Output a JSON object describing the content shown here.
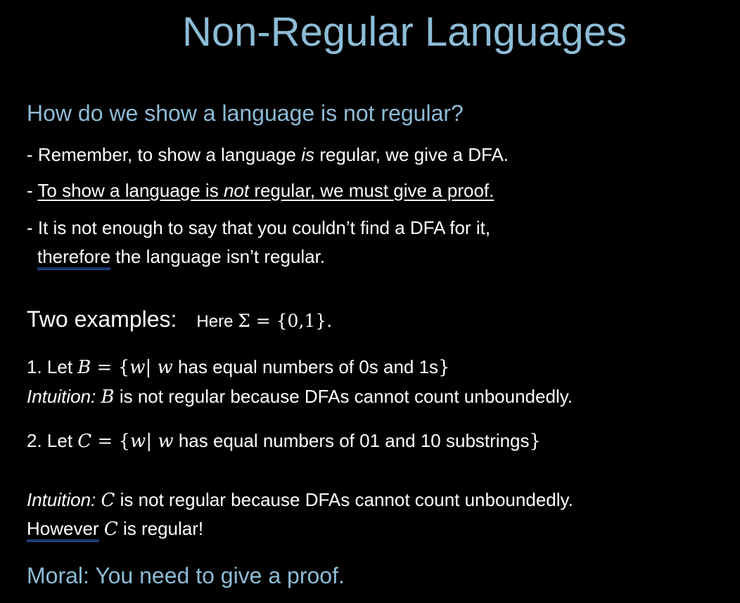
{
  "title": "Non-Regular Languages",
  "question": "How do we show a language is not regular?",
  "bullet1": {
    "a": "- Remember, to show a language ",
    "b": "is",
    "c": " regular, we give a DFA."
  },
  "bullet2": {
    "dash": "- ",
    "a": "To show a language is ",
    "b": "not",
    "c": " regular, we must give a proof."
  },
  "bullet3": {
    "line1": "- It is not enough to say that you couldn’t find a DFA for it,",
    "a": "therefore",
    "b": " the language isn’t regular."
  },
  "examples": {
    "heading": "Two examples:",
    "here": "Here ",
    "sigma": "Σ = {0,1}."
  },
  "ex1": {
    "a": "1.   Let ",
    "var": "B",
    "eq": " = {",
    "w": "w",
    "bar": "| ",
    "w2": "w",
    "b": " has equal numbers of 0s and 1s",
    "close": "}"
  },
  "int1": {
    "label": "Intuition:  ",
    "var": "B",
    "text": " is not regular because DFAs cannot count unboundedly."
  },
  "ex2": {
    "a": "2.  Let ",
    "var": "C",
    "eq": " = {",
    "w": "w",
    "bar": "| ",
    "w2": "w",
    "b": " has equal numbers of 01 and 10 substrings",
    "close": "}"
  },
  "int2": {
    "label": "Intuition:  ",
    "var": "C",
    "text": " is not regular because DFAs cannot count unboundedly."
  },
  "however": {
    "a": "However",
    "var": "C",
    "b": " is regular!"
  },
  "moral": "Moral:  You need to give a proof."
}
